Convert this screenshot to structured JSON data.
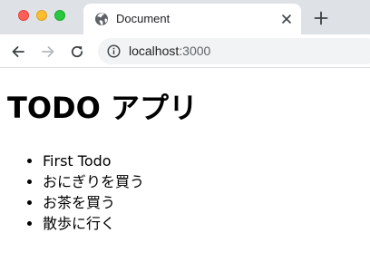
{
  "browser": {
    "tab": {
      "title": "Document",
      "favicon": "globe-icon"
    },
    "address_bar": {
      "host": "localhost",
      "port": ":3000"
    },
    "colors": {
      "tabstrip": "#dee1e6",
      "close": "#ff5f57",
      "minimize": "#febc2e",
      "maximize": "#28c840"
    }
  },
  "page": {
    "title": "TODO アプリ",
    "todos": [
      "First Todo",
      "おにぎりを買う",
      "お茶を買う",
      "散歩に行く"
    ]
  }
}
